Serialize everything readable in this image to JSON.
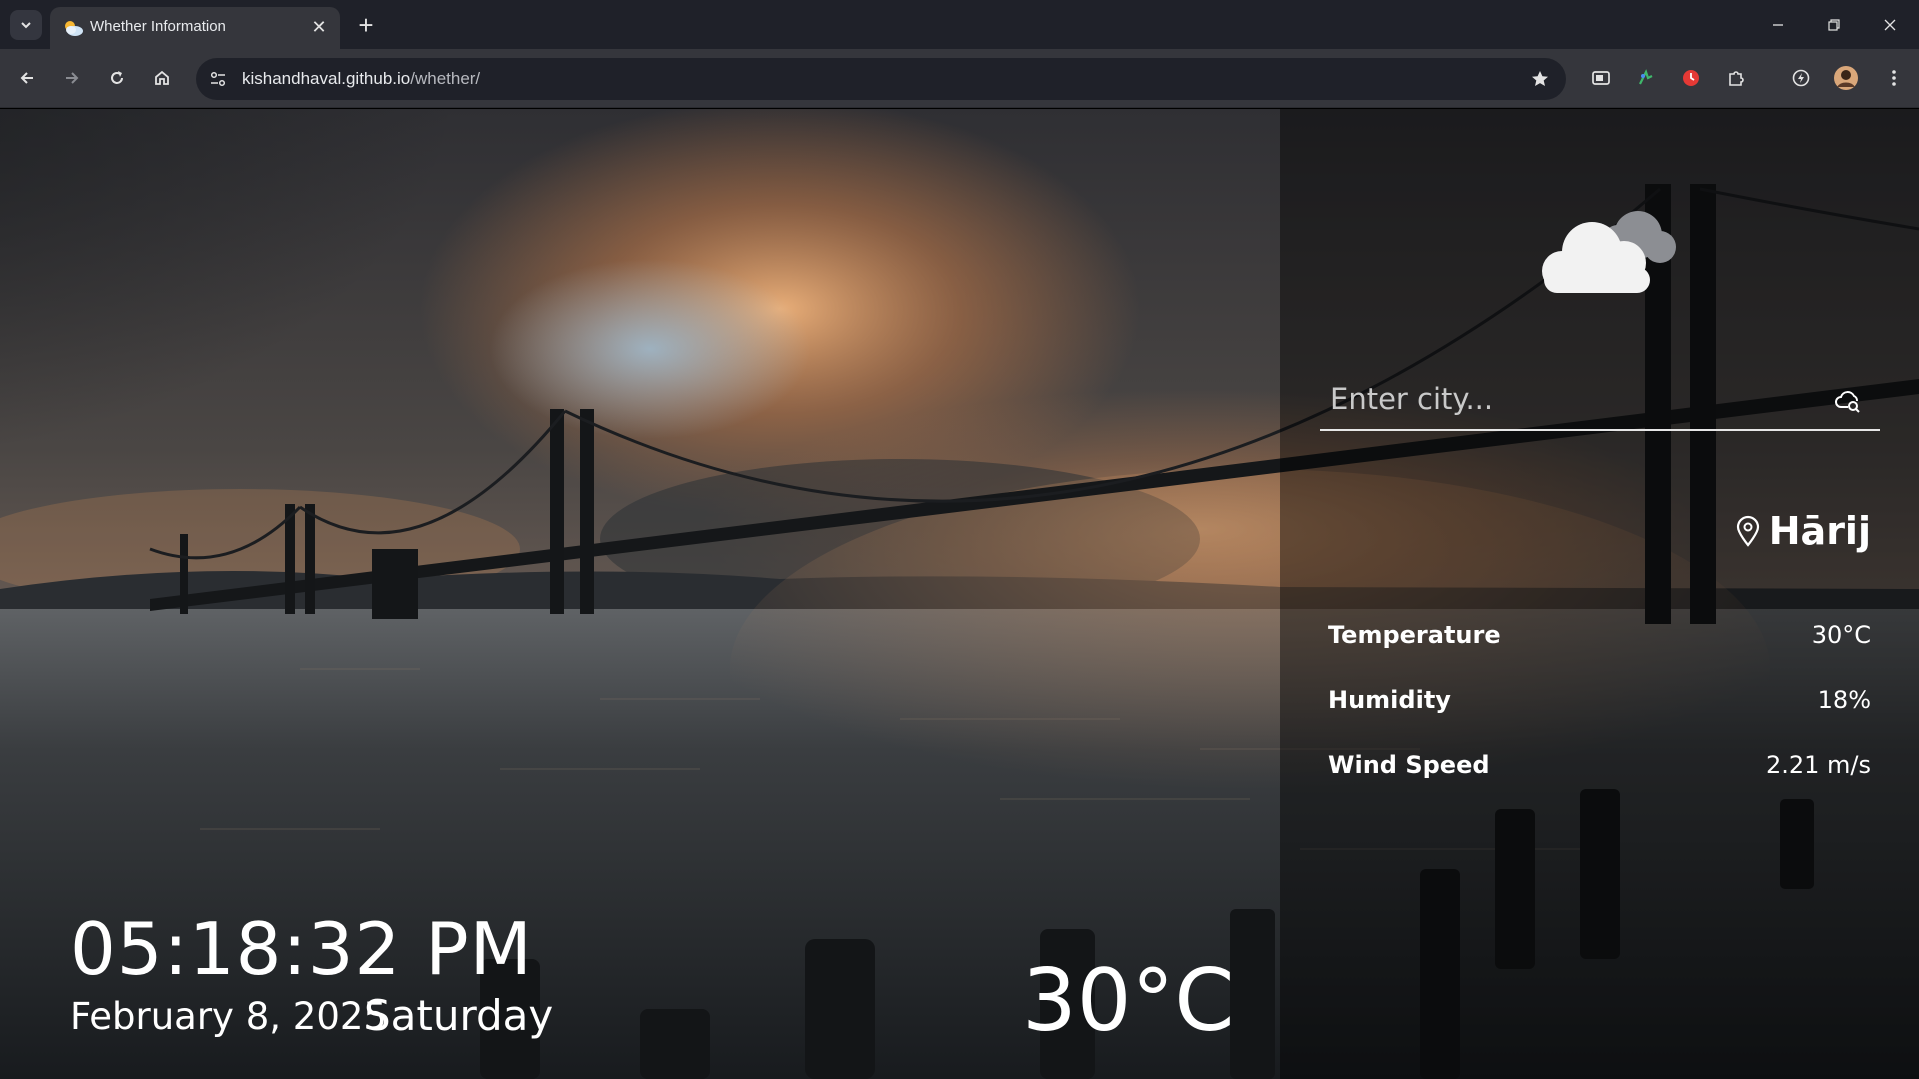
{
  "browser": {
    "tab_title": "Whether Information",
    "url_host": "kishandhaval.github.io",
    "url_path": "/whether/"
  },
  "page": {
    "search_placeholder": "Enter city...",
    "city": "Hārij",
    "stats": [
      {
        "label": "Temperature",
        "value": "30°C"
      },
      {
        "label": "Humidity",
        "value": "18%"
      },
      {
        "label": "Wind Speed",
        "value": "2.21 m/s"
      }
    ],
    "time": "05:18:32 PM",
    "date": "February 8, 2025",
    "day": "Saturday",
    "big_temperature": "30°C",
    "weather_condition_icon": "cloud-icon"
  },
  "colors": {
    "chrome_dark": "#1f2129",
    "chrome_toolbar": "#35363c",
    "text_white": "#ffffff"
  }
}
